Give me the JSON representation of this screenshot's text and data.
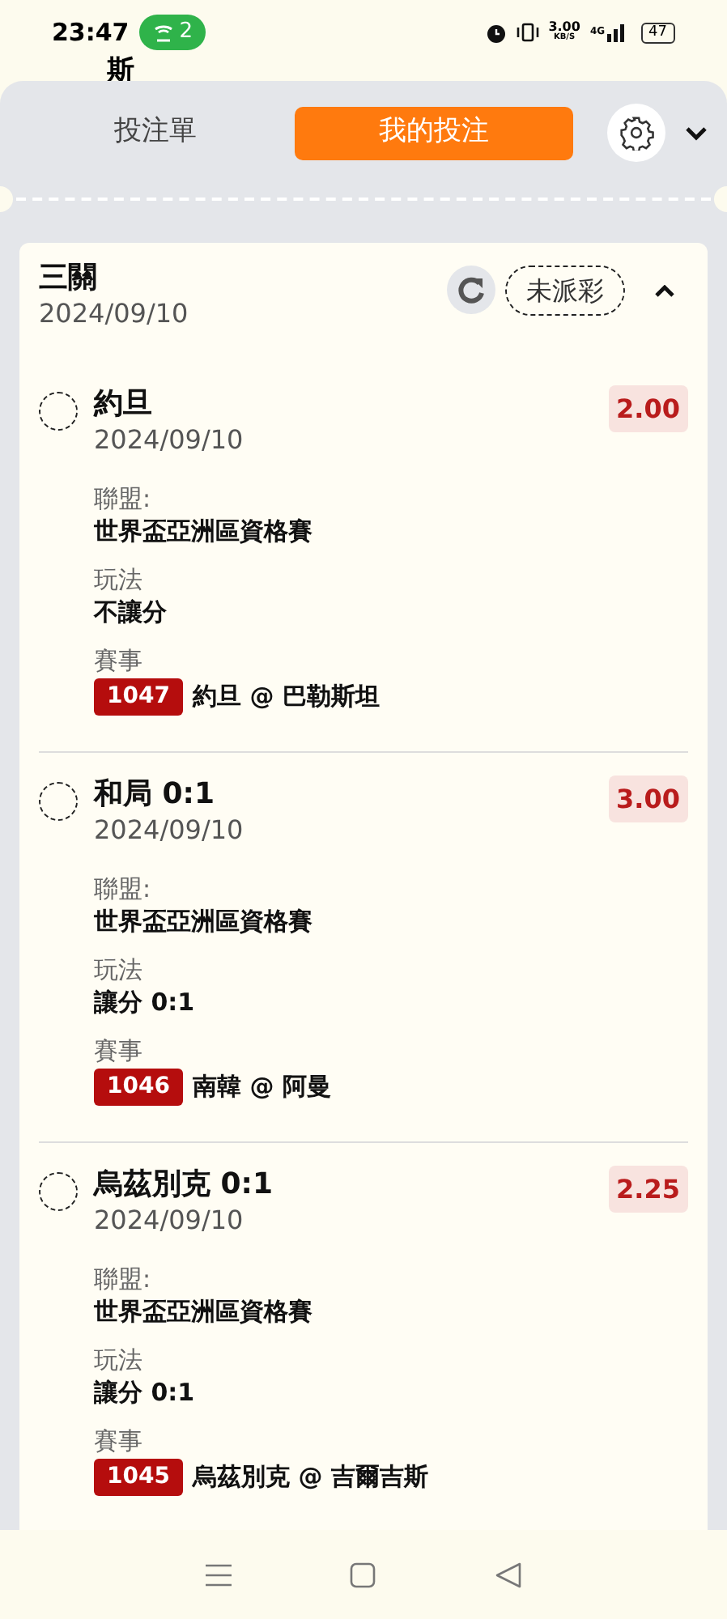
{
  "status_bar": {
    "time": "23:47",
    "hotspot_count": "2",
    "net_speed": "3.00",
    "net_unit": "KB/S",
    "network": "4G",
    "battery": "47"
  },
  "behind_text": "斯",
  "tabs": [
    {
      "label": "投注單",
      "selected": false
    },
    {
      "label": "我的投注",
      "selected": true
    }
  ],
  "bet": {
    "type": "三關",
    "date": "2024/09/10",
    "status": "未派彩",
    "expanded": true,
    "legs": [
      {
        "selection": "約旦",
        "date": "2024/09/10",
        "odds": "2.00",
        "league_label": "聯盟:",
        "league": "世界盃亞洲區資格賽",
        "market_label": "玩法",
        "market": "不讓分",
        "event_label": "賽事",
        "event_code": "1047",
        "event": "約旦 @ 巴勒斯坦"
      },
      {
        "selection": "和局 0:1",
        "date": "2024/09/10",
        "odds": "3.00",
        "league_label": "聯盟:",
        "league": "世界盃亞洲區資格賽",
        "market_label": "玩法",
        "market": "讓分 0:1",
        "event_label": "賽事",
        "event_code": "1046",
        "event": "南韓 @ 阿曼"
      },
      {
        "selection": "烏茲別克 0:1",
        "date": "2024/09/10",
        "odds": "2.25",
        "league_label": "聯盟:",
        "league": "世界盃亞洲區資格賽",
        "market_label": "玩法",
        "market": "讓分 0:1",
        "event_label": "賽事",
        "event_code": "1045",
        "event": "烏茲別克 @ 吉爾吉斯"
      }
    ]
  }
}
